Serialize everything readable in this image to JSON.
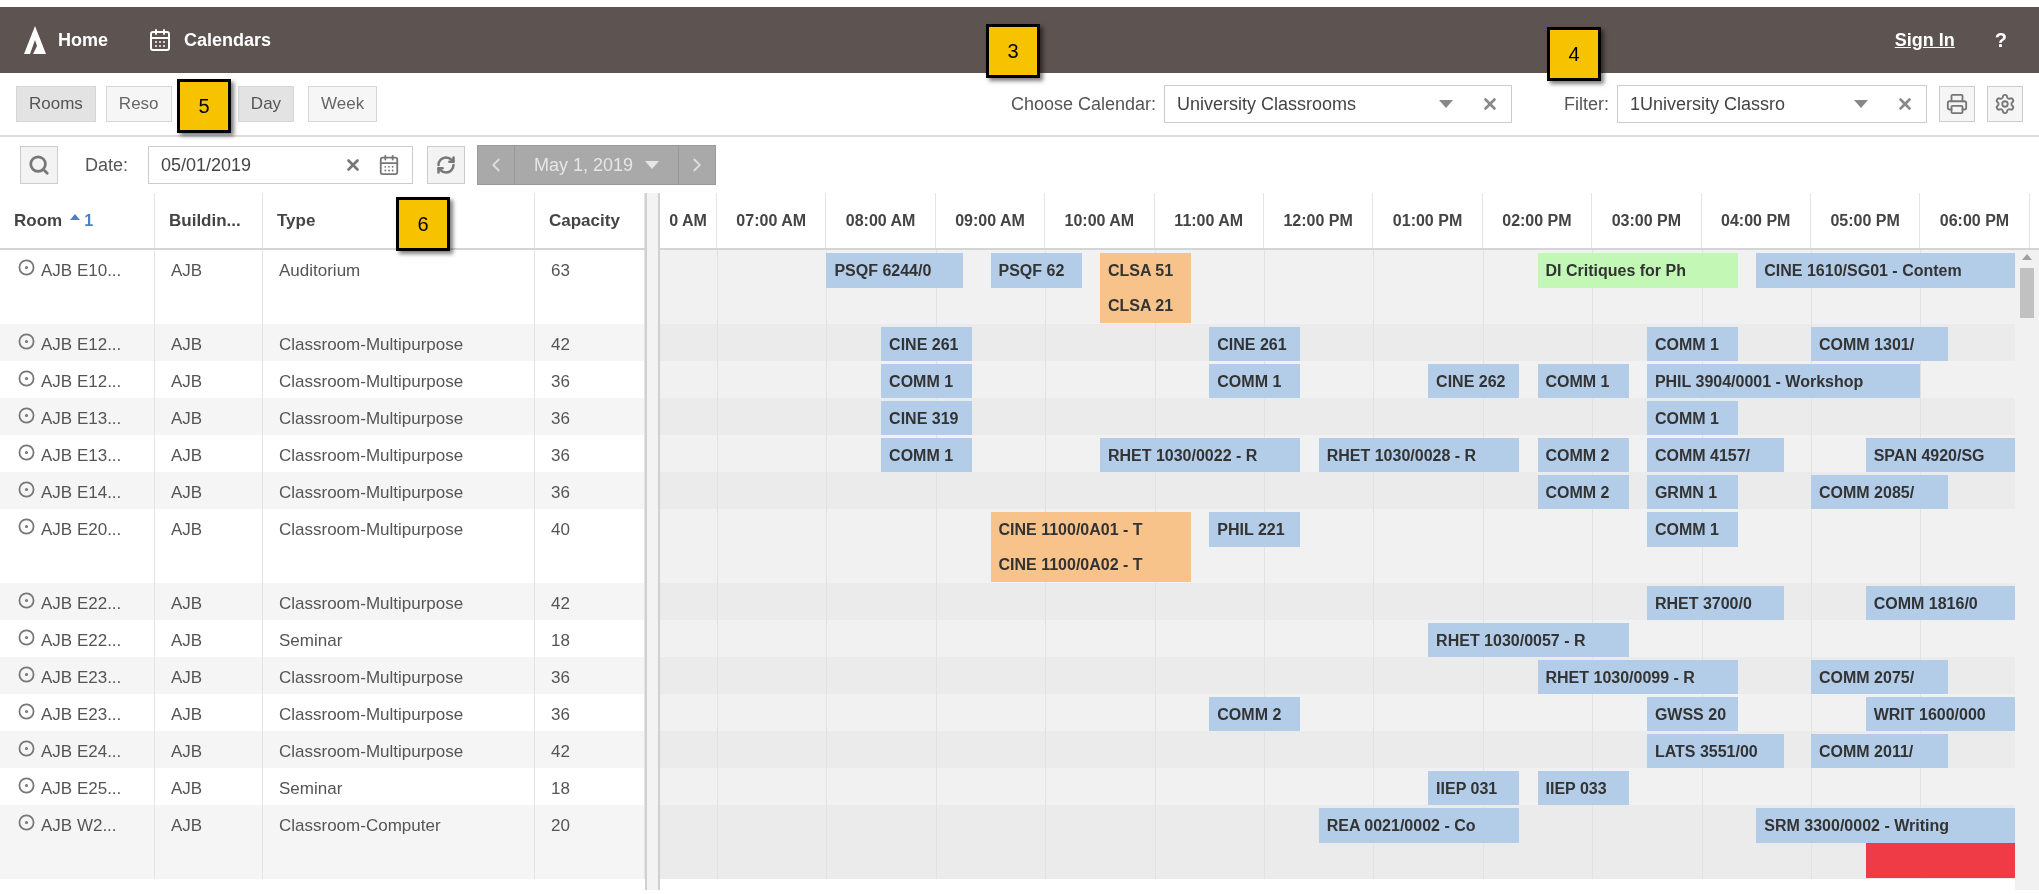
{
  "top_bar": {
    "links": [
      {
        "kind": "home",
        "label": "Home"
      },
      {
        "kind": "calendars",
        "label": "Calendars"
      }
    ],
    "sign_in": "Sign In",
    "help": "?"
  },
  "view_tabs": [
    {
      "label": "Rooms",
      "selected": true
    },
    {
      "label": "Reso",
      "selected": false
    }
  ],
  "range_tabs": [
    {
      "label": "Day",
      "selected": true
    },
    {
      "label": "Week",
      "selected": false
    }
  ],
  "calendar_picker": {
    "label": "Choose Calendar:",
    "value": "University Classrooms"
  },
  "filter": {
    "label": "Filter:",
    "value": "1University Classro"
  },
  "date_bar": {
    "label": "Date:",
    "value": "05/01/2019",
    "navigator": "May 1, 2019"
  },
  "table": {
    "columns": [
      {
        "label": "Room",
        "sort": "1"
      },
      {
        "label": "Buildin..."
      },
      {
        "label": "Type"
      },
      {
        "label": "Capacity"
      }
    ],
    "rows": [
      {
        "room": "AJB E10...",
        "building": "AJB",
        "type": "Auditorium",
        "capacity": "63",
        "events": [
          {
            "label": "PSQF 6244/0",
            "color": "#b3cde8"
          },
          {
            "label": "PSQF 62",
            "color": "#b3cde8"
          },
          {
            "label": "CLSA 51",
            "color": "#f7c38a"
          },
          {
            "label": "DI Critiques for Ph",
            "color": "#c2f7b6"
          },
          {
            "label": "CINE 1610/SG01 - Contem",
            "color": "#b3cde8"
          }
        ],
        "second_line_events": [
          {
            "label": "CLSA 21",
            "color": "#f7c38a"
          }
        ]
      },
      {
        "room": "AJB E12...",
        "building": "AJB",
        "type": "Classroom-Multipurpose",
        "capacity": "42",
        "events": [
          {
            "label": "CINE 261",
            "color": "#b3cde8"
          },
          {
            "label": "CINE 261",
            "color": "#b3cde8"
          },
          {
            "label": "COMM 1",
            "color": "#b3cde8"
          },
          {
            "label": "COMM 1301/",
            "color": "#b3cde8"
          }
        ]
      },
      {
        "room": "AJB E12...",
        "building": "AJB",
        "type": "Classroom-Multipurpose",
        "capacity": "36",
        "events": [
          {
            "label": "COMM 1",
            "color": "#b3cde8"
          },
          {
            "label": "COMM 1",
            "color": "#b3cde8"
          },
          {
            "label": "CINE 262",
            "color": "#b3cde8"
          },
          {
            "label": "COMM 1",
            "color": "#b3cde8"
          },
          {
            "label": "PHIL 3904/0001 - Workshop",
            "color": "#b3cde8"
          }
        ]
      },
      {
        "room": "AJB E13...",
        "building": "AJB",
        "type": "Classroom-Multipurpose",
        "capacity": "36",
        "events": [
          {
            "label": "CINE 319",
            "color": "#b3cde8"
          },
          {
            "label": "COMM 1",
            "color": "#b3cde8"
          }
        ]
      },
      {
        "room": "AJB E13...",
        "building": "AJB",
        "type": "Classroom-Multipurpose",
        "capacity": "36",
        "events": [
          {
            "label": "COMM 1",
            "color": "#b3cde8"
          },
          {
            "label": "RHET 1030/0022 - R",
            "color": "#b3cde8"
          },
          {
            "label": "RHET 1030/0028 - R",
            "color": "#b3cde8"
          },
          {
            "label": "COMM 2",
            "color": "#b3cde8"
          },
          {
            "label": "COMM 4157/",
            "color": "#b3cde8"
          },
          {
            "label": "SPAN 4920/SG",
            "color": "#b3cde8"
          }
        ]
      },
      {
        "room": "AJB E14...",
        "building": "AJB",
        "type": "Classroom-Multipurpose",
        "capacity": "36",
        "events": [
          {
            "label": "COMM 2",
            "color": "#b3cde8"
          },
          {
            "label": "GRMN 1",
            "color": "#b3cde8"
          },
          {
            "label": "COMM 2085/",
            "color": "#b3cde8"
          }
        ]
      },
      {
        "room": "AJB E20...",
        "building": "AJB",
        "type": "Classroom-Multipurpose",
        "capacity": "40",
        "events": [
          {
            "label": "CINE 1100/0A01 - T",
            "color": "#f7c38a"
          },
          {
            "label": "PHIL 221",
            "color": "#b3cde8"
          },
          {
            "label": "COMM 1",
            "color": "#b3cde8"
          }
        ],
        "second_line_events": [
          {
            "label": "CINE 1100/0A02 - T",
            "color": "#f7c38a"
          }
        ]
      },
      {
        "room": "AJB E22...",
        "building": "AJB",
        "type": "Classroom-Multipurpose",
        "capacity": "42",
        "events": [
          {
            "label": "RHET 3700/0",
            "color": "#b3cde8"
          },
          {
            "label": "COMM 1816/0",
            "color": "#b3cde8"
          }
        ]
      },
      {
        "room": "AJB E22...",
        "building": "AJB",
        "type": "Seminar",
        "capacity": "18",
        "events": [
          {
            "label": "RHET 1030/0057 - R",
            "color": "#b3cde8"
          }
        ]
      },
      {
        "room": "AJB E23...",
        "building": "AJB",
        "type": "Classroom-Multipurpose",
        "capacity": "36",
        "events": [
          {
            "label": "RHET 1030/0099 - R",
            "color": "#b3cde8"
          },
          {
            "label": "COMM 2075/",
            "color": "#b3cde8"
          }
        ]
      },
      {
        "room": "AJB E23...",
        "building": "AJB",
        "type": "Classroom-Multipurpose",
        "capacity": "36",
        "events": [
          {
            "label": "COMM 2",
            "color": "#b3cde8"
          },
          {
            "label": "GWSS 20",
            "color": "#b3cde8"
          },
          {
            "label": "WRIT 1600/000",
            "color": "#b3cde8"
          }
        ]
      },
      {
        "room": "AJB E24...",
        "building": "AJB",
        "type": "Classroom-Multipurpose",
        "capacity": "42",
        "events": [
          {
            "label": "LATS 3551/00",
            "color": "#b3cde8"
          },
          {
            "label": "COMM 2011/",
            "color": "#b3cde8"
          }
        ]
      },
      {
        "room": "AJB E25...",
        "building": "AJB",
        "type": "Seminar",
        "capacity": "18",
        "events": [
          {
            "label": "IIEP 031",
            "color": "#b3cde8"
          },
          {
            "label": "IIEP 033",
            "color": "#b3cde8"
          }
        ]
      },
      {
        "room": "AJB W2...",
        "building": "AJB",
        "type": "Classroom-Computer",
        "capacity": "20",
        "events": [
          {
            "label": "REA 0021/0002 - Co",
            "color": "#b3cde8"
          },
          {
            "label": "SRM 3300/0002 - Writing",
            "color": "#b3cde8"
          }
        ],
        "second_line_events": [
          {
            "color": "#ef3b45"
          }
        ]
      }
    ]
  },
  "timeline": {
    "hours": [
      "0 AM",
      "07:00 AM",
      "08:00 AM",
      "09:00 AM",
      "10:00 AM",
      "11:00 AM",
      "12:00 PM",
      "01:00 PM",
      "02:00 PM",
      "03:00 PM",
      "04:00 PM",
      "05:00 PM",
      "06:00 PM"
    ]
  },
  "callouts": [
    "3",
    "4",
    "5",
    "6"
  ]
}
